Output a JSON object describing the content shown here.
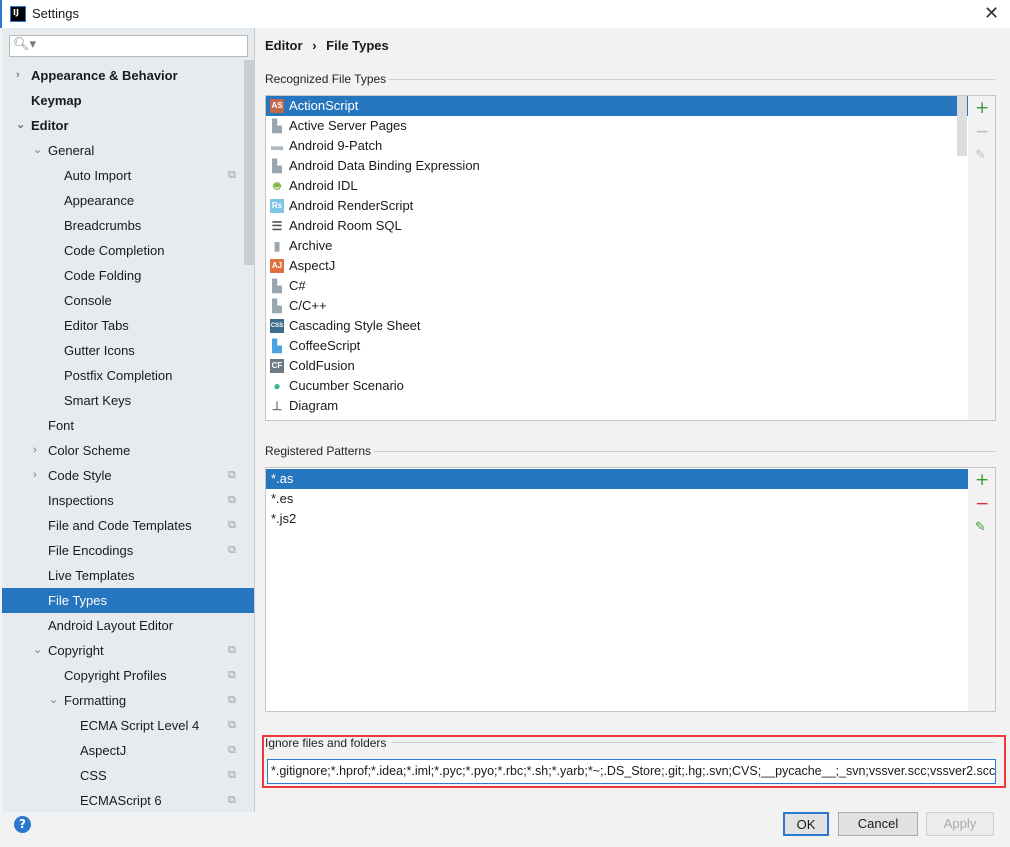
{
  "window": {
    "title": "Settings",
    "app_icon": "IJ"
  },
  "search": {
    "placeholder": ""
  },
  "sidebar": {
    "items": [
      {
        "label": "Appearance & Behavior",
        "level": 0,
        "bold": true,
        "arrow": "›"
      },
      {
        "label": "Keymap",
        "level": 0,
        "bold": true
      },
      {
        "label": "Editor",
        "level": 0,
        "bold": true,
        "arrow": "⌄"
      },
      {
        "label": "General",
        "level": 1,
        "arrow": "⌄"
      },
      {
        "label": "Auto Import",
        "level": 2,
        "copy": true
      },
      {
        "label": "Appearance",
        "level": 2
      },
      {
        "label": "Breadcrumbs",
        "level": 2
      },
      {
        "label": "Code Completion",
        "level": 2
      },
      {
        "label": "Code Folding",
        "level": 2
      },
      {
        "label": "Console",
        "level": 2
      },
      {
        "label": "Editor Tabs",
        "level": 2
      },
      {
        "label": "Gutter Icons",
        "level": 2
      },
      {
        "label": "Postfix Completion",
        "level": 2
      },
      {
        "label": "Smart Keys",
        "level": 2
      },
      {
        "label": "Font",
        "level": 1
      },
      {
        "label": "Color Scheme",
        "level": 1,
        "arrow": "›"
      },
      {
        "label": "Code Style",
        "level": 1,
        "arrow": "›",
        "copy": true
      },
      {
        "label": "Inspections",
        "level": 1,
        "copy": true
      },
      {
        "label": "File and Code Templates",
        "level": 1,
        "copy": true
      },
      {
        "label": "File Encodings",
        "level": 1,
        "copy": true
      },
      {
        "label": "Live Templates",
        "level": 1
      },
      {
        "label": "File Types",
        "level": 1,
        "selected": true
      },
      {
        "label": "Android Layout Editor",
        "level": 1
      },
      {
        "label": "Copyright",
        "level": 1,
        "arrow": "⌄",
        "copy": true
      },
      {
        "label": "Copyright Profiles",
        "level": 2,
        "copy": true
      },
      {
        "label": "Formatting",
        "level": 2,
        "arrow": "⌄",
        "copy": true
      },
      {
        "label": "ECMA Script Level 4",
        "level": 3,
        "copy": true
      },
      {
        "label": "AspectJ",
        "level": 3,
        "copy": true
      },
      {
        "label": "CSS",
        "level": 3,
        "copy": true
      },
      {
        "label": "ECMAScript 6",
        "level": 3,
        "copy": true
      }
    ]
  },
  "breadcrumb": {
    "parent": "Editor",
    "sep": "›",
    "current": "File Types"
  },
  "recognized": {
    "label": "Recognized File Types",
    "items": [
      {
        "label": "ActionScript",
        "icon": "AS",
        "color": "#c0694a",
        "selected": true
      },
      {
        "label": "Active Server Pages",
        "icon": "file-icon",
        "color": "#9aa7b0"
      },
      {
        "label": "Android 9-Patch",
        "icon": "folder-icon",
        "color": "#b0b8bf"
      },
      {
        "label": "Android Data Binding Expression",
        "icon": "file-icon",
        "color": "#9aa7b0"
      },
      {
        "label": "Android IDL",
        "icon": "android-icon",
        "color": "#7cb342"
      },
      {
        "label": "Android RenderScript",
        "icon": "Rs",
        "color": "#7fc3e8"
      },
      {
        "label": "Android Room SQL",
        "icon": "table-icon",
        "color": "#555555"
      },
      {
        "label": "Archive",
        "icon": "archive-icon",
        "color": "#9aa7b0"
      },
      {
        "label": "AspectJ",
        "icon": "AJ",
        "color": "#e07040"
      },
      {
        "label": "C#",
        "icon": "file-icon",
        "color": "#9aa7b0"
      },
      {
        "label": "C/C++",
        "icon": "file-icon",
        "color": "#9aa7b0"
      },
      {
        "label": "Cascading Style Sheet",
        "icon": "CSS",
        "color": "#3d6d8c"
      },
      {
        "label": "CoffeeScript",
        "icon": "file-icon",
        "color": "#4aa3df"
      },
      {
        "label": "ColdFusion",
        "icon": "CF",
        "color": "#6d7a85"
      },
      {
        "label": "Cucumber Scenario",
        "icon": "cucumber-icon",
        "color": "#3bb58a"
      },
      {
        "label": "Diagram",
        "icon": "diagram-icon",
        "color": "#6d7a85"
      }
    ]
  },
  "patterns": {
    "label": "Registered Patterns",
    "items": [
      "*.as",
      "*.es",
      "*.js2"
    ]
  },
  "ignore": {
    "label": "Ignore files and folders",
    "value": "*.gitignore;*.hprof;*.idea;*.iml;*.pyc;*.pyo;*.rbc;*.sh;*.yarb;*~;.DS_Store;.git;.hg;.svn;CVS;__pycache__;_svn;vssver.scc;vssver2.scc;"
  },
  "buttons": {
    "ok": "OK",
    "cancel": "Cancel",
    "apply": "Apply",
    "help": "?"
  },
  "colors": {
    "accent": "#2675bf",
    "highlight_box": "#f03a3a"
  }
}
